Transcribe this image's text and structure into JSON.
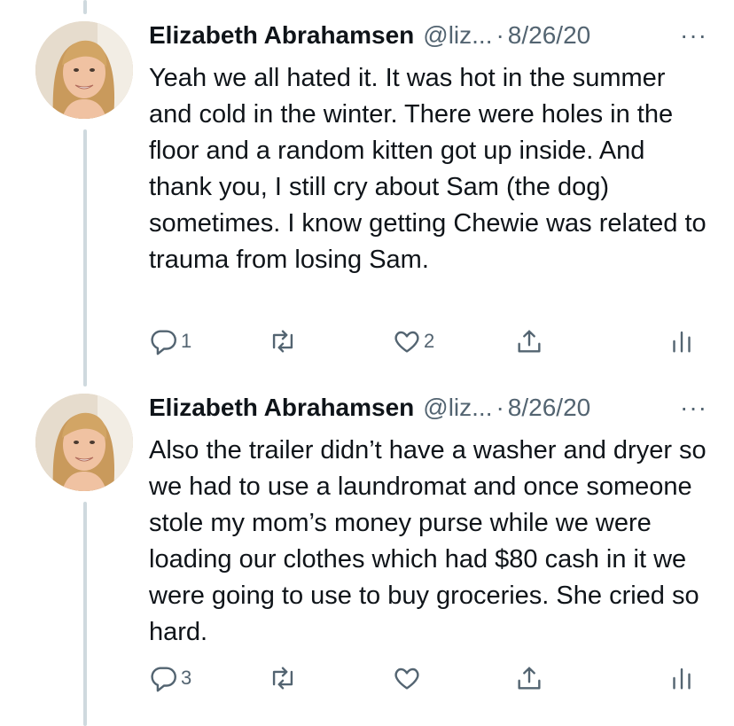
{
  "tweets": [
    {
      "name": "Elizabeth Abrahamsen",
      "handle": "@liz...",
      "separator": "·",
      "date": "8/26/20",
      "more": "···",
      "text": "Yeah we all hated it. It was hot in the summer and cold in the winter. There were holes in the floor and a random kitten got up inside. And thank you, I still cry about Sam (the dog) sometimes. I know getting Chewie was related to trauma from losing Sam.",
      "reply_count": "1",
      "retweet_count": "",
      "like_count": "2"
    },
    {
      "name": "Elizabeth Abrahamsen",
      "handle": "@liz...",
      "separator": "·",
      "date": "8/26/20",
      "more": "···",
      "text": "Also the trailer didn’t have a washer and dryer so we had to use a laundromat and once someone stole my mom’s money purse while we were loading our clothes which had $80 cash in it we were going to use to buy groceries. She cried so hard.",
      "reply_count": "3",
      "retweet_count": "",
      "like_count": ""
    }
  ],
  "icons": {
    "reply": "reply-icon",
    "retweet": "retweet-icon",
    "like": "like-icon",
    "share": "share-icon",
    "analytics": "analytics-icon"
  },
  "colors": {
    "text": "#0f1419",
    "secondary": "#536471",
    "thread_line": "#cfd9de"
  }
}
